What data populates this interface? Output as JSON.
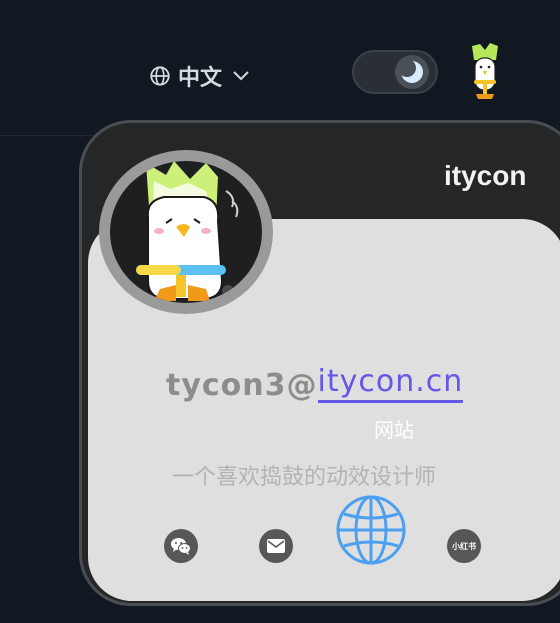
{
  "header": {
    "language_label": "中文"
  },
  "profile": {
    "name": "itycon",
    "email_user": "tycon3@",
    "email_domain": "itycon.cn",
    "website_label": "网站",
    "tagline": "一个喜欢捣鼓的动效设计师"
  },
  "social": {
    "xiaohongshu_label": "小红书"
  },
  "colors": {
    "background": "#111821",
    "accent": "#6656e8",
    "globe": "#4d9ff0"
  },
  "icons": [
    "globe-icon",
    "chevron-down-icon",
    "moon-icon",
    "mascot-icon",
    "wechat-icon",
    "mail-icon",
    "xiaohongshu-icon"
  ]
}
